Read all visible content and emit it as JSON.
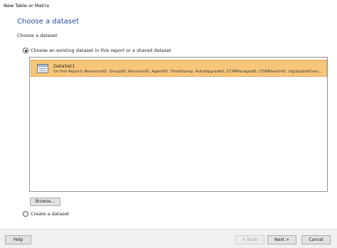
{
  "window": {
    "title": "New Table or Matrix"
  },
  "page": {
    "heading": "Choose a dataset",
    "subheading": "Choose a dataset"
  },
  "options": {
    "existing_label": "Choose an existing dataset in this report or a shared dataset",
    "existing_selected": true,
    "create_label": "Create a dataset",
    "create_selected": false
  },
  "datasets": [
    {
      "name": "DataSet1",
      "fields": "(in this Report) ResourceID, GroupID, RevisionID, AgentID, TimeStamp, AutoUpgrade0, CCMManaged0, CDNBaseUrl0, cfgUpdateOran..."
    }
  ],
  "buttons": {
    "browse": "Browse...",
    "help": "Help",
    "back": "< Back",
    "next": "Next >",
    "cancel": "Cancel"
  },
  "colors": {
    "selection": "#f7c67a",
    "heading": "#1f4e9e"
  }
}
